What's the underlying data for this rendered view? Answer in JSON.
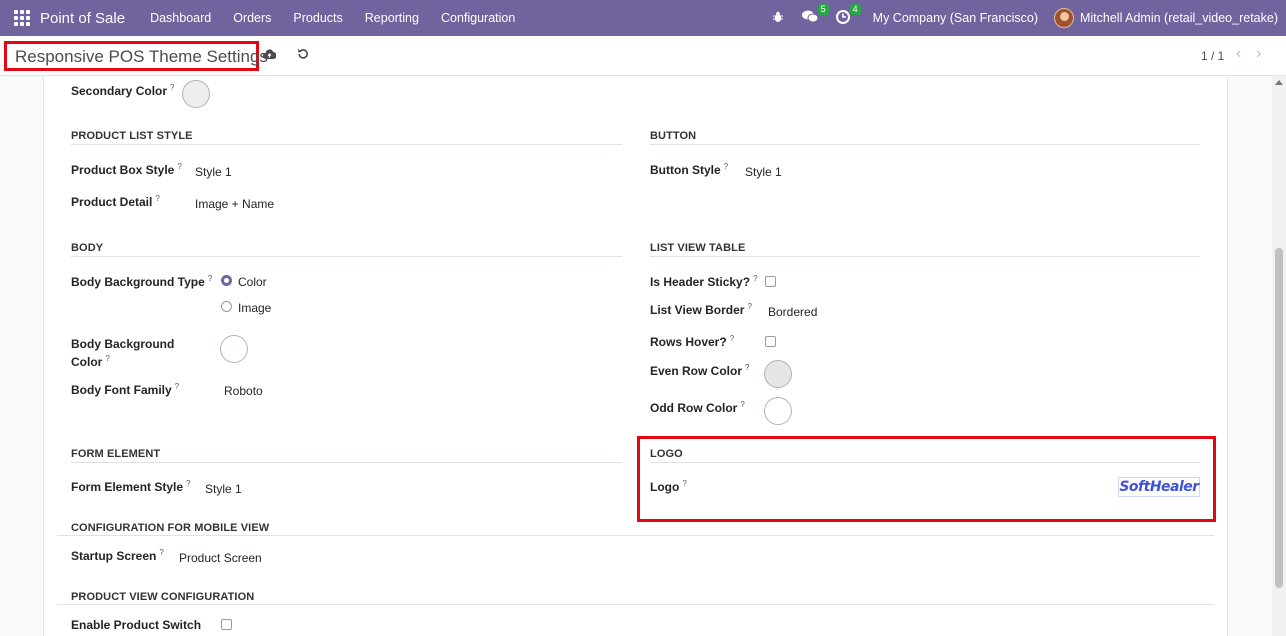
{
  "navbar": {
    "brand": "Point of Sale",
    "menu": [
      "Dashboard",
      "Orders",
      "Products",
      "Reporting",
      "Configuration"
    ],
    "messages_count": "5",
    "activities_count": "4",
    "company": "My Company (San Francisco)",
    "user": "Mitchell Admin (retail_video_retake)"
  },
  "control_panel": {
    "breadcrumb": "Responsive POS Theme Settings",
    "pager": "1 / 1"
  },
  "form": {
    "secondary_color": {
      "label": "Secondary Color",
      "help": "?",
      "color": "#eeeeee"
    },
    "product_list_style": {
      "title": "PRODUCT LIST STYLE",
      "product_box_style": {
        "label": "Product Box Style",
        "help": "?",
        "value": "Style 1"
      },
      "product_detail": {
        "label": "Product Detail",
        "help": "?",
        "value": "Image + Name"
      }
    },
    "button": {
      "title": "BUTTON",
      "button_style": {
        "label": "Button Style",
        "help": "?",
        "value": "Style 1"
      }
    },
    "body": {
      "title": "BODY",
      "background_type": {
        "label": "Body Background Type",
        "help": "?",
        "options": [
          "Color",
          "Image"
        ],
        "selected": "Color"
      },
      "background_color": {
        "label_line1": "Body Background",
        "label_line2": "Color",
        "help": "?",
        "color": "#ffffff"
      },
      "font_family": {
        "label": "Body Font Family",
        "help": "?",
        "value": "Roboto"
      }
    },
    "list_view_table": {
      "title": "LIST VIEW TABLE",
      "header_sticky": {
        "label": "Is Header Sticky?",
        "help": "?",
        "checked": false
      },
      "border": {
        "label": "List View Border",
        "help": "?",
        "value": "Bordered"
      },
      "rows_hover": {
        "label": "Rows Hover?",
        "help": "?",
        "checked": false
      },
      "even_row_color": {
        "label": "Even Row Color",
        "help": "?",
        "color": "#e6e6e6"
      },
      "odd_row_color": {
        "label": "Odd Row Color",
        "help": "?",
        "color": "#ffffff"
      }
    },
    "form_element": {
      "title": "FORM ELEMENT",
      "style": {
        "label": "Form Element Style",
        "help": "?",
        "value": "Style 1"
      }
    },
    "logo": {
      "title": "LOGO",
      "label": "Logo",
      "help": "?",
      "image_text": "SoftHealer"
    },
    "mobile_view": {
      "title": "CONFIGURATION FOR MOBILE VIEW",
      "startup_screen": {
        "label": "Startup Screen",
        "help": "?",
        "value": "Product Screen"
      }
    },
    "product_view": {
      "title": "PRODUCT VIEW CONFIGURATION",
      "enable_switch": {
        "label": "Enable Product Switch",
        "checked": false
      }
    }
  },
  "colors": {
    "navbar": "#71639e",
    "highlight": "#e30613",
    "badge": "#28a745"
  }
}
